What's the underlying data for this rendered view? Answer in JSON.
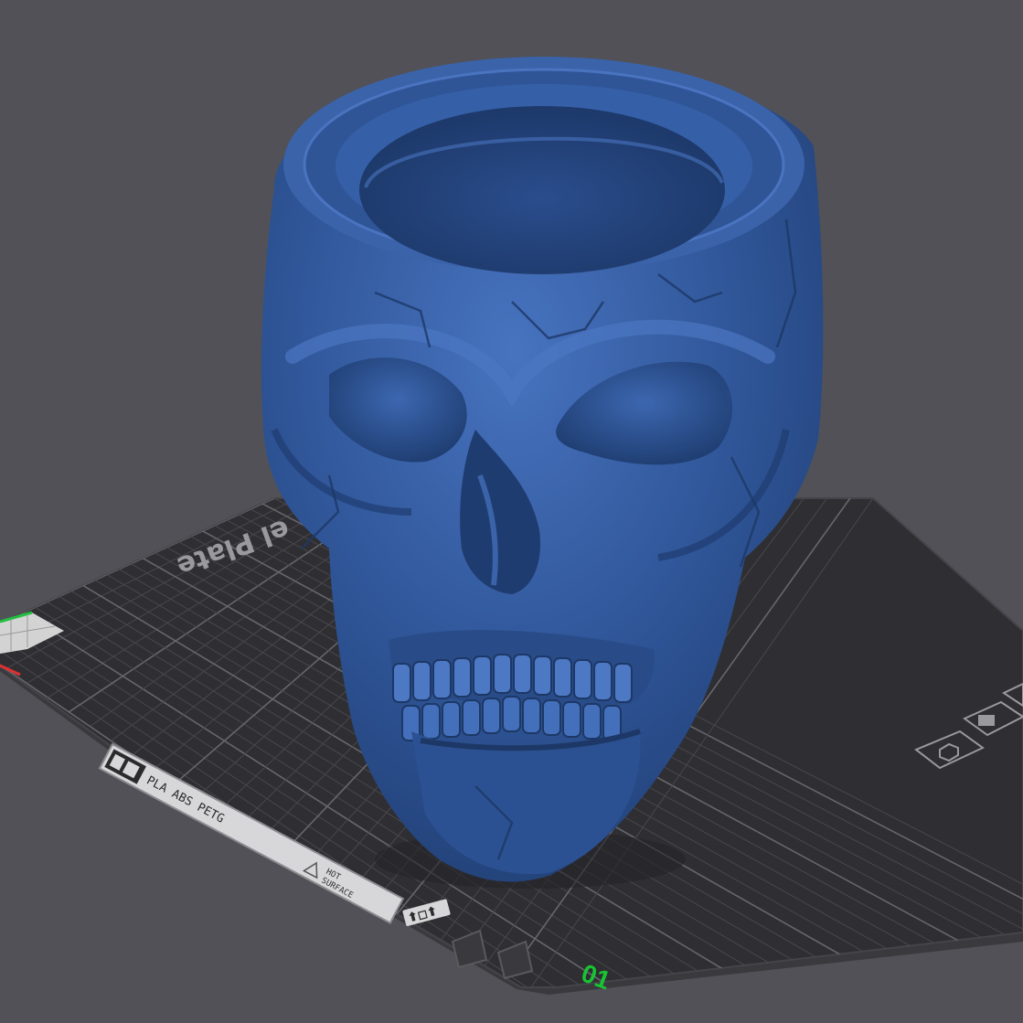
{
  "scene": {
    "background_color": "#525157",
    "plate_color": "#2f2f33",
    "plate_edge_color": "#3a393e",
    "grid_color": "#55545a",
    "model_color": "#2f5597",
    "model_highlight": "#4a74c0",
    "model_shadow": "#1d3866"
  },
  "build_plate": {
    "name_text": "el Plate",
    "plate_number": "01",
    "plate_number_color": "#18c432",
    "label_strip": {
      "material_text": "PLA ABS PETG",
      "hot_surface_line1": "HOT",
      "hot_surface_line2": "SURFACE"
    }
  },
  "axes": {
    "x_color": "#e03030",
    "y_color": "#20c040"
  }
}
